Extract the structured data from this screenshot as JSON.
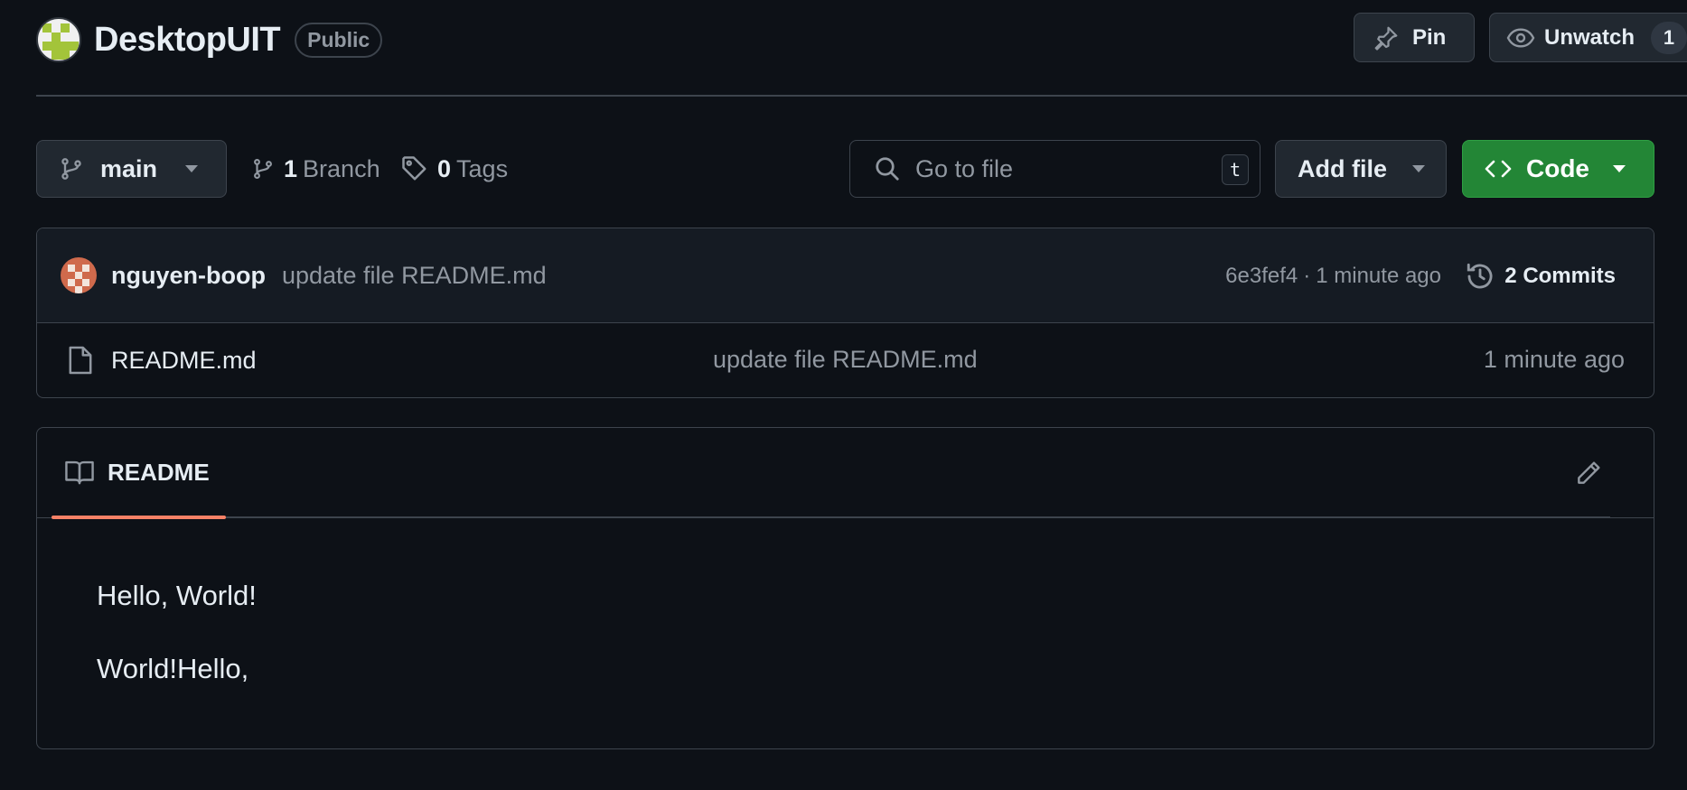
{
  "repo": {
    "name": "DesktopUIT",
    "visibility": "Public"
  },
  "header_actions": {
    "pin_label": "Pin",
    "unwatch_label": "Unwatch",
    "watch_count": "1"
  },
  "toolbar": {
    "branch": "main",
    "branch_count": "1",
    "branch_label": "Branch",
    "tag_count": "0",
    "tag_label": "Tags",
    "search_placeholder": "Go to file",
    "search_shortcut": "t",
    "add_file_label": "Add file",
    "code_label": "Code"
  },
  "latest_commit": {
    "author": "nguyen-boop",
    "message": "update file README.md",
    "hash": "6e3fef4",
    "separator": "·",
    "time": "1 minute ago",
    "commits_label": "2 Commits"
  },
  "files": [
    {
      "name": "README.md",
      "message": "update file README.md",
      "time": "1 minute ago"
    }
  ],
  "readme": {
    "tab_label": "README",
    "lines": [
      "Hello, World!",
      "World!Hello,"
    ]
  },
  "colors": {
    "background": "#0d1117",
    "accent_green": "#238636",
    "tab_underline": "#f78166"
  },
  "icons": [
    "pin-icon",
    "eye-icon",
    "git-branch-icon",
    "tag-icon",
    "search-icon",
    "code-icon",
    "history-icon",
    "file-icon",
    "book-icon",
    "pencil-icon",
    "triangle-down-icon"
  ]
}
